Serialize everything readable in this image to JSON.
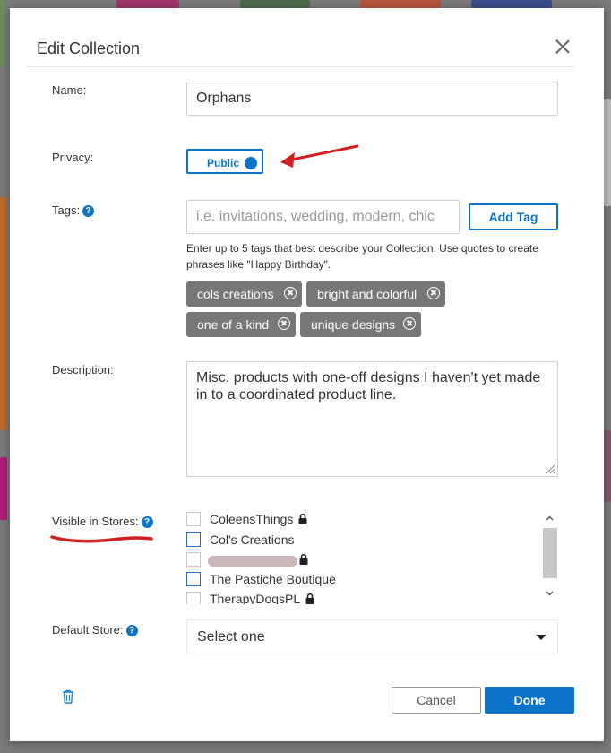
{
  "dialog": {
    "title": "Edit Collection"
  },
  "name_field": {
    "label": "Name:",
    "value": "Orphans"
  },
  "privacy": {
    "label": "Privacy:",
    "value": "Public"
  },
  "tags": {
    "label": "Tags:",
    "placeholder": "i.e. invitations, wedding, modern, chic",
    "add_button": "Add Tag",
    "helper": "Enter up to 5 tags that best describe your Collection. Use quotes to create phrases like \"Happy Birthday\".",
    "items": [
      "cols creations",
      "bright and colorful",
      "one of a kind",
      "unique designs"
    ]
  },
  "description": {
    "label": "Description:",
    "value": "Misc. products with one-off designs I haven't yet made in to a coordinated product line."
  },
  "stores": {
    "label": "Visible in Stores:",
    "items": [
      {
        "name": "ColeensThings",
        "locked": true
      },
      {
        "name": "Col's Creations",
        "locked": false
      },
      {
        "name": "",
        "locked": true
      },
      {
        "name": "The Pastiche Boutique",
        "locked": false
      },
      {
        "name": "TherapyDogsPL",
        "locked": true
      }
    ]
  },
  "default_store": {
    "label": "Default Store:",
    "value": "Select one"
  },
  "footer": {
    "cancel": "Cancel",
    "done": "Done"
  },
  "colors": {
    "accent": "#0b74c9",
    "annotation": "#d21f1f",
    "chip": "#777777"
  }
}
